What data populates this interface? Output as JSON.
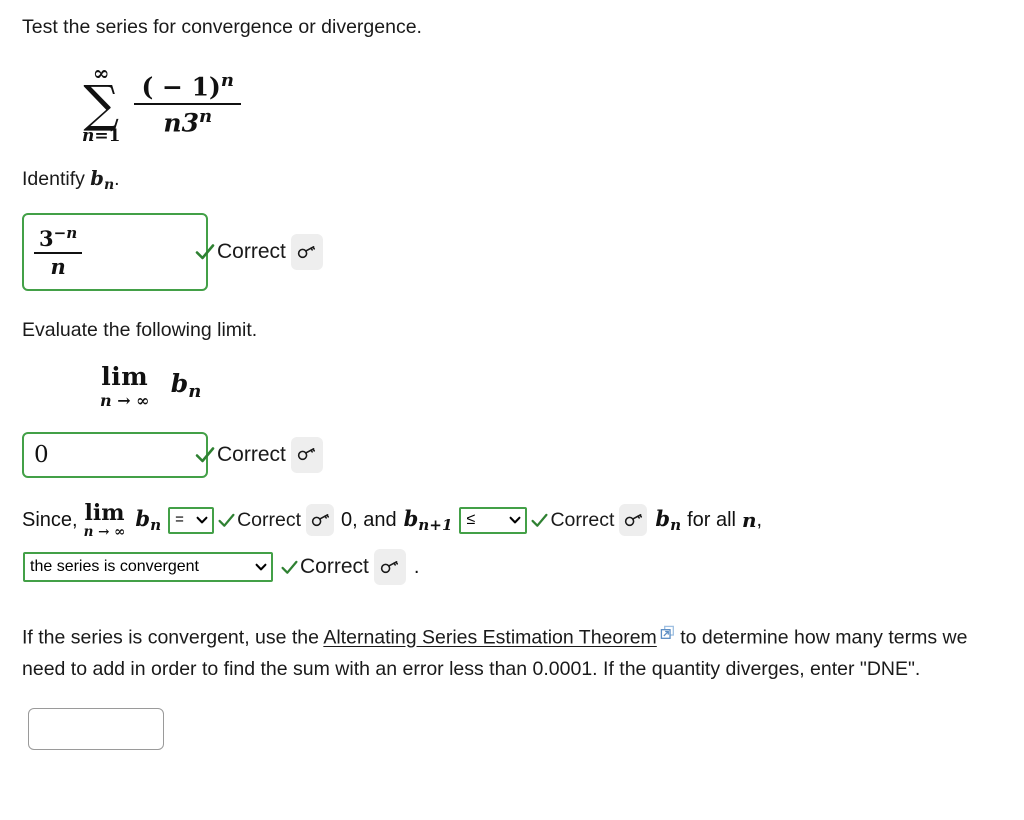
{
  "problem": {
    "prompt": "Test the series for convergence or divergence.",
    "series": {
      "sigma_top": "∞",
      "sigma_glyph": "∑",
      "sigma_bottom_var": "n",
      "sigma_bottom_eq": "=",
      "sigma_bottom_val": "1",
      "numerator_open": "( − 1)",
      "numerator_exp": "n",
      "denominator_base": "n3",
      "denominator_exp": "n"
    }
  },
  "identify": {
    "prompt_text": "Identify ",
    "prompt_symbol": "b",
    "prompt_symbol_sub": "n",
    "prompt_period": ".",
    "answer": {
      "numerator_base": "3",
      "numerator_exp": "−n",
      "denominator": "n"
    },
    "status": "Correct",
    "check_glyph": "✔",
    "key_glyph": "⚷"
  },
  "limit": {
    "prompt": "Evaluate the following limit.",
    "lim_word": "lim",
    "lim_to": "n → ∞",
    "lim_arg": "b",
    "lim_arg_sub": "n",
    "answer_value": "0",
    "status": "Correct",
    "check_glyph": "✔",
    "key_glyph": "⚷"
  },
  "since": {
    "lead": "Since,",
    "lim_word": "lim",
    "lim_to": "n → ∞",
    "bn": "b",
    "bn_sub": "n",
    "compare1_value": "=",
    "compare1_status": "Correct",
    "mid_text": "0, and",
    "bn1": "b",
    "bn1_sub": "n+1",
    "compare2_value": "≤",
    "compare2_status": "Correct",
    "tail_bn": "b",
    "tail_bn_sub": "n",
    "tail_text": "for all",
    "tail_var": "n",
    "tail_comma": ",",
    "conclusion_value": "the series is convergent",
    "conclusion_status": "Correct",
    "final_period": ".",
    "check_glyph": "✔",
    "key_glyph": "⚷",
    "caret_glyph": "⌄"
  },
  "estimation": {
    "text_before_link": "If the series is convergent, use the ",
    "link_text": "Alternating Series Estimation Theorem",
    "text_after_link": " to determine how many terms we need to add in order to find the sum with an error less than 0.0001. If the quantity diverges, enter \"DNE\".",
    "answer_value": "",
    "answer_placeholder": ""
  },
  "colors": {
    "correct_border": "#43a047",
    "check_mark": "#2f8132",
    "key_button_bg": "#eeeeee",
    "blank_border": "#9a9a9a",
    "link_icon": "#7da7d9",
    "text": "#1a1a1a"
  }
}
